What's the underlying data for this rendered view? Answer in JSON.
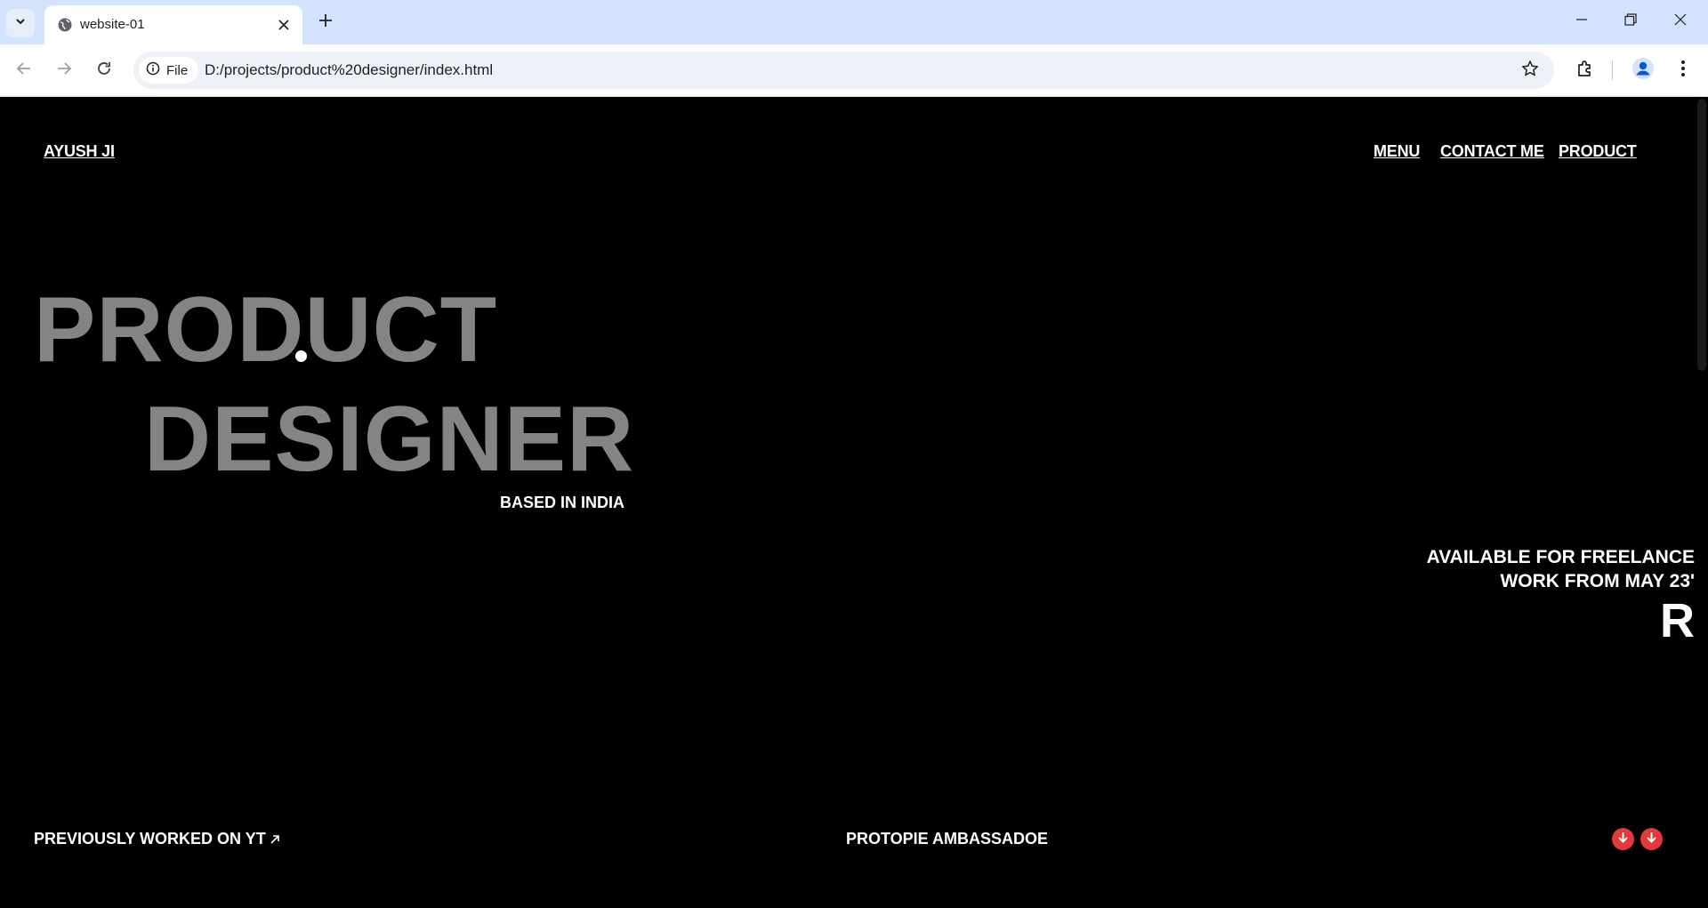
{
  "browser": {
    "tab_title": "website-01",
    "site_chip_label": "File",
    "url": "D:/projects/product%20designer/index.html"
  },
  "page": {
    "logo": "AYUSH JI",
    "nav": {
      "menu": "MENU",
      "contact": "CONTACT ME",
      "product": "PRODUCT"
    },
    "hero": {
      "line1": "PRODUCT",
      "line2": "DESIGNER"
    },
    "location": "BASED IN INDIA",
    "availability": {
      "line1": "AVAILABLE FOR FREELANCE",
      "line2": "WORK FROM MAY 23'"
    },
    "big_letter": "R",
    "footer": {
      "previously": "PREVIOUSLY WORKED ON YT",
      "ambassador": "PROTOPIE AMBASSADOE"
    }
  },
  "colors": {
    "page_background": "#000000",
    "hero_text": "#848484",
    "accent_red": "#e5373c",
    "tabstrip": "#d3e3fd"
  },
  "icons": [
    "tab-search-chevron-icon",
    "globe-icon",
    "close-icon",
    "plus-icon",
    "minimize-icon",
    "restore-icon",
    "window-close-icon",
    "back-arrow-icon",
    "forward-arrow-icon",
    "reload-icon",
    "info-icon",
    "star-icon",
    "extensions-icon",
    "profile-icon",
    "kebab-menu-icon",
    "external-link-arrow-icon",
    "arrow-down-circle-icon"
  ]
}
